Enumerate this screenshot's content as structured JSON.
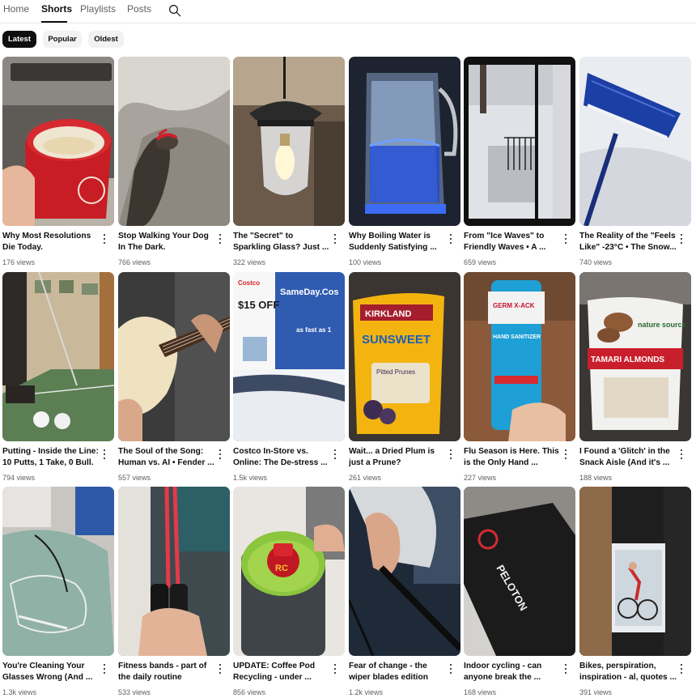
{
  "tabs": [
    {
      "label": "Home"
    },
    {
      "label": "Shorts"
    },
    {
      "label": "Playlists"
    },
    {
      "label": "Posts"
    }
  ],
  "active_tab": "Shorts",
  "chips": [
    {
      "label": "Latest"
    },
    {
      "label": "Popular"
    },
    {
      "label": "Oldest"
    }
  ],
  "selected_chip": "Latest",
  "shorts": [
    {
      "title": "Why Most Resolutions Die Today.",
      "views": "176 views"
    },
    {
      "title": "Stop Walking Your Dog In The Dark.",
      "views": "766 views"
    },
    {
      "title": "The \"Secret\" to Sparkling Glass? Just ...",
      "views": "322 views"
    },
    {
      "title": "Why Boiling Water is Suddenly Satisfying ...",
      "views": "100 views"
    },
    {
      "title": "From \"Ice Waves\" to Friendly Waves • A ...",
      "views": "659 views"
    },
    {
      "title": "The Reality of the \"Feels Like\" -23°C • The Snow...",
      "views": "740 views"
    },
    {
      "title": "Putting - Inside the Line: 10 Putts, 1 Take, 0 Bull.",
      "views": "794 views"
    },
    {
      "title": "The Soul of the Song: Human vs. AI • Fender ...",
      "views": "557 views"
    },
    {
      "title": "Costco In-Store vs. Online: The De-stress ...",
      "views": "1.5k views"
    },
    {
      "title": "Wait... a Dried Plum is just a Prune?",
      "views": "261 views"
    },
    {
      "title": "Flu Season is Here. This is the Only Hand ...",
      "views": "227 views"
    },
    {
      "title": "I Found a 'Glitch' in the Snack Aisle (And it's ...",
      "views": "188 views"
    },
    {
      "title": "You're Cleaning Your Glasses Wrong (And ...",
      "views": "1.3k views"
    },
    {
      "title": "Fitness bands - part of the daily routine",
      "views": "533 views"
    },
    {
      "title": "UPDATE: Coffee Pod Recycling - under ...",
      "views": "856 views"
    },
    {
      "title": "Fear of change - the wiper blades edition",
      "views": "1.2k views"
    },
    {
      "title": "Indoor cycling - can anyone break the ...",
      "views": "168 views"
    },
    {
      "title": "Bikes, perspiration, inspiration - al, quotes ...",
      "views": "391 views"
    }
  ],
  "thumbnail_text": {
    "t8_brand": "Costco",
    "t8_sameday": "SameDay.Cos",
    "t8_offer": "$15 OFF",
    "t8_fast": "as fast as 1",
    "t9_brand": "KIRKLAND",
    "t9_product": "SUNSWEET",
    "t9_sub": "Pitted Prunes",
    "t10_brand": "GERM X-ACK",
    "t10_product": "HAND SANITIZER",
    "t11_brand": "nature source",
    "t11_product": "TAMARI ALMONDS",
    "t14_cap": "RC",
    "t16_brand": "PELOTON"
  },
  "colors": {
    "text": "#0f0f0f",
    "secondary_text": "#606060",
    "chip_bg": "#f2f2f2",
    "chip_selected_bg": "#0f0f0f"
  }
}
